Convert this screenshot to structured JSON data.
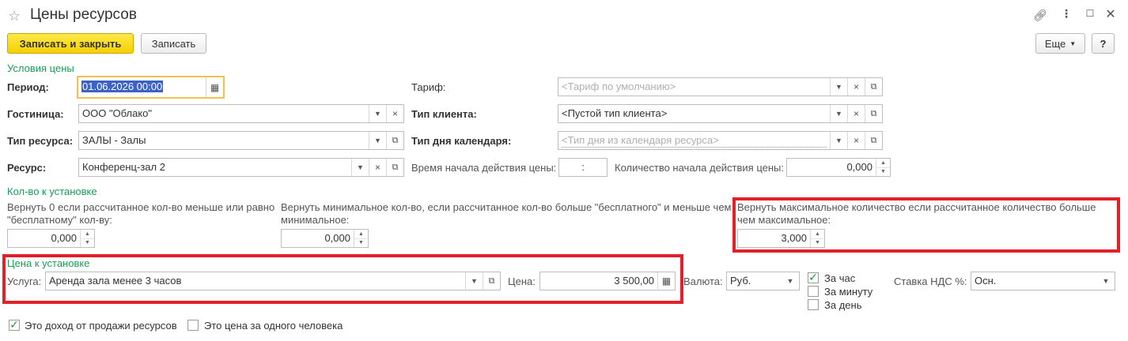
{
  "window": {
    "title": "Цены ресурсов"
  },
  "toolbar": {
    "save_close_label": "Записать и закрыть",
    "save_label": "Записать",
    "more_label": "Еще",
    "help_label": "?"
  },
  "price_conditions": {
    "group_title": "Условия цены",
    "period_label": "Период:",
    "period_value": "01.06.2026 00:00",
    "hotel_label": "Гостиница:",
    "hotel_value": "ООО \"Облако\"",
    "resource_type_label": "Тип ресурса:",
    "resource_type_value": "ЗАЛЫ - Залы",
    "resource_label": "Ресурс:",
    "resource_value": "Конференц-зал 2",
    "tariff_label": "Тариф:",
    "tariff_placeholder": "<Тариф по умолчанию>",
    "client_type_label": "Тип клиента:",
    "client_type_value": "<Пустой тип клиента>",
    "calendar_day_type_label": "Тип дня календаря:",
    "calendar_day_type_placeholder": "<Тип дня из календаря ресурса>",
    "start_time_label": "Время начала действия цены:",
    "start_time_value": ":",
    "start_qty_label": "Количество начала действия цены:",
    "start_qty_value": "0,000"
  },
  "quantity_setup": {
    "group_title": "Кол-во к установке",
    "zero_label": "Вернуть 0 если рассчитанное кол-во меньше или равно \"бесплатному\" кол-ву:",
    "zero_value": "0,000",
    "min_label": "Вернуть минимальное кол-во, если рассчитанное кол-во больше \"бесплатного\" и меньше чем минимальное:",
    "min_value": "0,000",
    "max_label": "Вернуть максимальное количество если рассчитанное количество больше чем максимальное:",
    "max_value": "3,000"
  },
  "price_setup": {
    "group_title": "Цена к установке",
    "service_label": "Услуга:",
    "service_value": "Аренда зала менее 3 часов",
    "price_label": "Цена:",
    "price_value": "3 500,00",
    "currency_label": "Валюта:",
    "currency_value": "Руб.",
    "per_hour_label": "За час",
    "per_hour_checked": true,
    "per_minute_label": "За минуту",
    "per_minute_checked": false,
    "per_day_label": "За день",
    "per_day_checked": false,
    "vat_label": "Ставка НДС %:",
    "vat_value": "Осн."
  },
  "flags": {
    "resource_income_label": "Это доход от продажи ресурсов",
    "resource_income_checked": true,
    "per_person_label": "Это цена за одного человека",
    "per_person_checked": false
  },
  "colors": {
    "group_title": "#18a057",
    "primary_button": "#f5d100",
    "highlight_box": "#e3202a",
    "focus_border": "#f2c14e",
    "selection": "#3b62c4"
  }
}
